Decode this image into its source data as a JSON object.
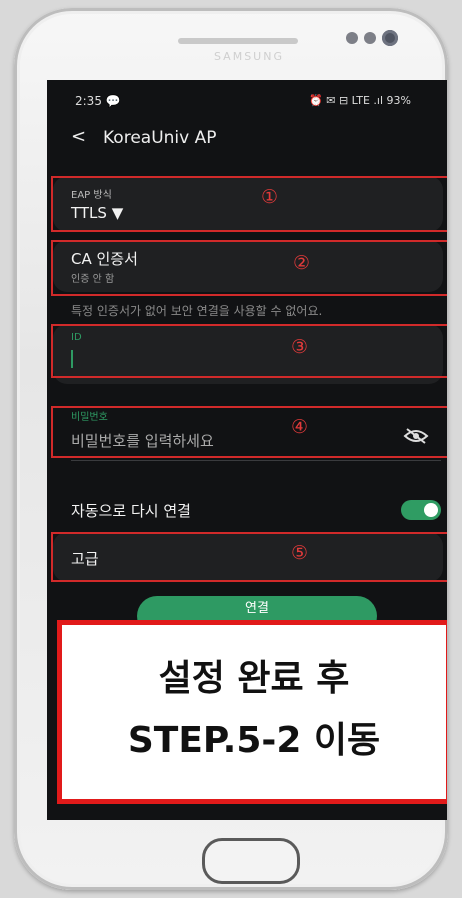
{
  "phone": {
    "brand": "SAMSUNG"
  },
  "status_bar": {
    "time": "2:35",
    "message_icon": "chat-bubble-icon",
    "right": "⏰ ✉ ⊟ LTE .ıl 93%",
    "battery": "93%"
  },
  "header": {
    "back_icon": "chevron-left-icon",
    "title": "KoreaUniv AP"
  },
  "eap": {
    "label": "EAP 방식",
    "value": "TTLS",
    "dropdown_icon": "caret-down-icon",
    "number": "①"
  },
  "ca": {
    "label": "CA 인증서",
    "value": "인증 안 함",
    "number": "②",
    "warning": "특정 인증서가 없어 보안 연결을 사용할 수 없어요."
  },
  "identity": {
    "label": "ID",
    "value": "",
    "number": "③"
  },
  "password": {
    "label": "비밀번호",
    "placeholder": "비밀번호를 입력하세요",
    "visibility_icon": "eye-off-icon",
    "number": "④"
  },
  "auto_reconnect": {
    "label": "자동으로 다시 연결",
    "enabled": true
  },
  "advanced": {
    "label": "고급",
    "number": "⑤"
  },
  "connect_button": {
    "label": "연결"
  },
  "overlay": {
    "line1": "설정 완료 후",
    "line2": "STEP.5-2 이동"
  },
  "colors": {
    "accent_green": "#2e9a63",
    "highlight_red": "#d12a2a",
    "background": "#111214"
  }
}
